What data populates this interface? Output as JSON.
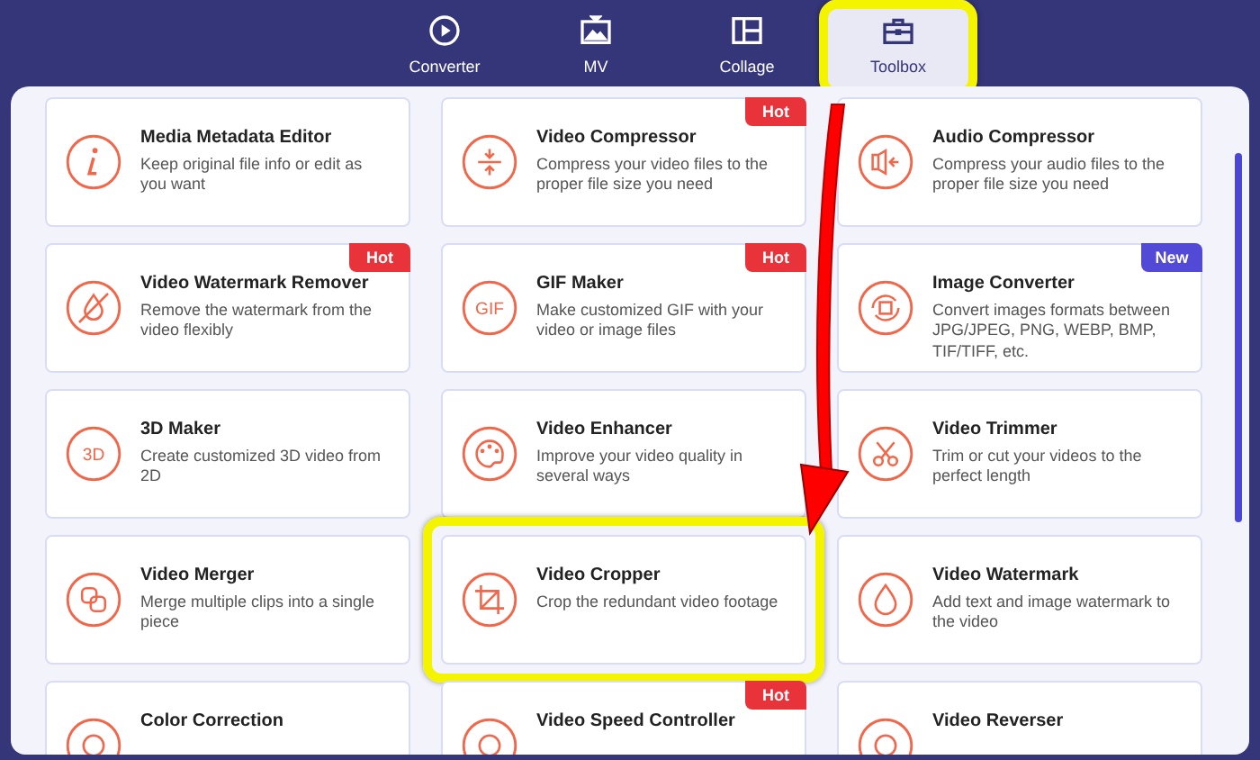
{
  "tabs": [
    {
      "label": "Converter",
      "selected": false,
      "highlighted": false
    },
    {
      "label": "MV",
      "selected": false,
      "highlighted": false
    },
    {
      "label": "Collage",
      "selected": false,
      "highlighted": false
    },
    {
      "label": "Toolbox",
      "selected": true,
      "highlighted": true
    }
  ],
  "pointer_arrow": true,
  "tools": [
    {
      "title": "Media Metadata Editor",
      "description": "Keep original file info or edit as you want",
      "highlighted": false
    },
    {
      "title": "Video Compressor",
      "description": "Compress your video files to the proper file size you need",
      "badge": {
        "label": "Hot",
        "kind": "hot"
      },
      "highlighted": false
    },
    {
      "title": "Audio Compressor",
      "description": "Compress your audio files to the proper file size you need",
      "highlighted": false
    },
    {
      "title": "Video Watermark Remover",
      "description": "Remove the watermark from the video flexibly",
      "badge": {
        "label": "Hot",
        "kind": "hot"
      },
      "highlighted": false
    },
    {
      "title": "GIF Maker",
      "icon_label": "GIF",
      "description": "Make customized GIF with your video or image files",
      "badge": {
        "label": "Hot",
        "kind": "hot"
      },
      "highlighted": false
    },
    {
      "title": "Image Converter",
      "description": "Convert images formats between JPG/JPEG, PNG, WEBP, BMP, TIF/TIFF, etc.",
      "badge": {
        "label": "New",
        "kind": "new"
      },
      "highlighted": false
    },
    {
      "title": "3D Maker",
      "icon_label": "3D",
      "description": "Create customized 3D video from 2D",
      "highlighted": false
    },
    {
      "title": "Video Enhancer",
      "description": "Improve your video quality in several ways",
      "highlighted": false
    },
    {
      "title": "Video Trimmer",
      "description": "Trim or cut your videos to the perfect length",
      "highlighted": false
    },
    {
      "title": "Video Merger",
      "description": "Merge multiple clips into a single piece",
      "highlighted": false
    },
    {
      "title": "Video Cropper",
      "description": "Crop the redundant video footage",
      "highlighted": true
    },
    {
      "title": "Video Watermark",
      "description": "Add text and image watermark to the video",
      "highlighted": false
    },
    {
      "title": "Color Correction",
      "highlighted": false
    },
    {
      "title": "Video Speed Controller",
      "badge": {
        "label": "Hot",
        "kind": "hot"
      },
      "highlighted": false
    },
    {
      "title": "Video Reverser",
      "highlighted": false
    }
  ]
}
